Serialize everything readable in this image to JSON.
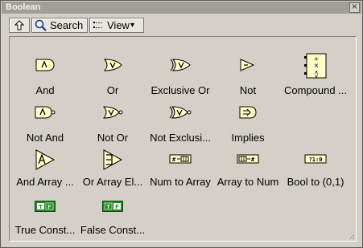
{
  "window": {
    "title": "Boolean",
    "close_glyph": "×"
  },
  "toolbar": {
    "up_icon": "up-arrow-icon",
    "search_label": "Search",
    "view_label": "View",
    "view_caret": "▾"
  },
  "palette": {
    "items": [
      {
        "label": "And",
        "icon": "and-gate-icon"
      },
      {
        "label": "Or",
        "icon": "or-gate-icon"
      },
      {
        "label": "Exclusive Or",
        "icon": "xor-gate-icon"
      },
      {
        "label": "Not",
        "icon": "not-gate-icon"
      },
      {
        "label": "Compound ...",
        "icon": "compound-arithmetic-icon"
      },
      {
        "label": "Not And",
        "icon": "nand-gate-icon"
      },
      {
        "label": "Not Or",
        "icon": "nor-gate-icon"
      },
      {
        "label": "Not Exclusi...",
        "icon": "xnor-gate-icon"
      },
      {
        "label": "Implies",
        "icon": "implies-icon"
      },
      {
        "label": "And Array ...",
        "icon": "and-array-icon"
      },
      {
        "label": "Or Array El...",
        "icon": "or-array-icon"
      },
      {
        "label": "Num to Array",
        "icon": "num-to-array-icon"
      },
      {
        "label": "Array to Num",
        "icon": "array-to-num-icon"
      },
      {
        "label": "Bool to (0,1)",
        "icon": "bool-to-01-icon"
      },
      {
        "label": "True Const...",
        "icon": "true-constant-icon"
      },
      {
        "label": "False Const...",
        "icon": "false-constant-icon"
      }
    ]
  },
  "colors": {
    "icon_fill": "#ffffc8",
    "constant_green": "#1f8a1f",
    "panel_bg": "#d4d0c8"
  }
}
